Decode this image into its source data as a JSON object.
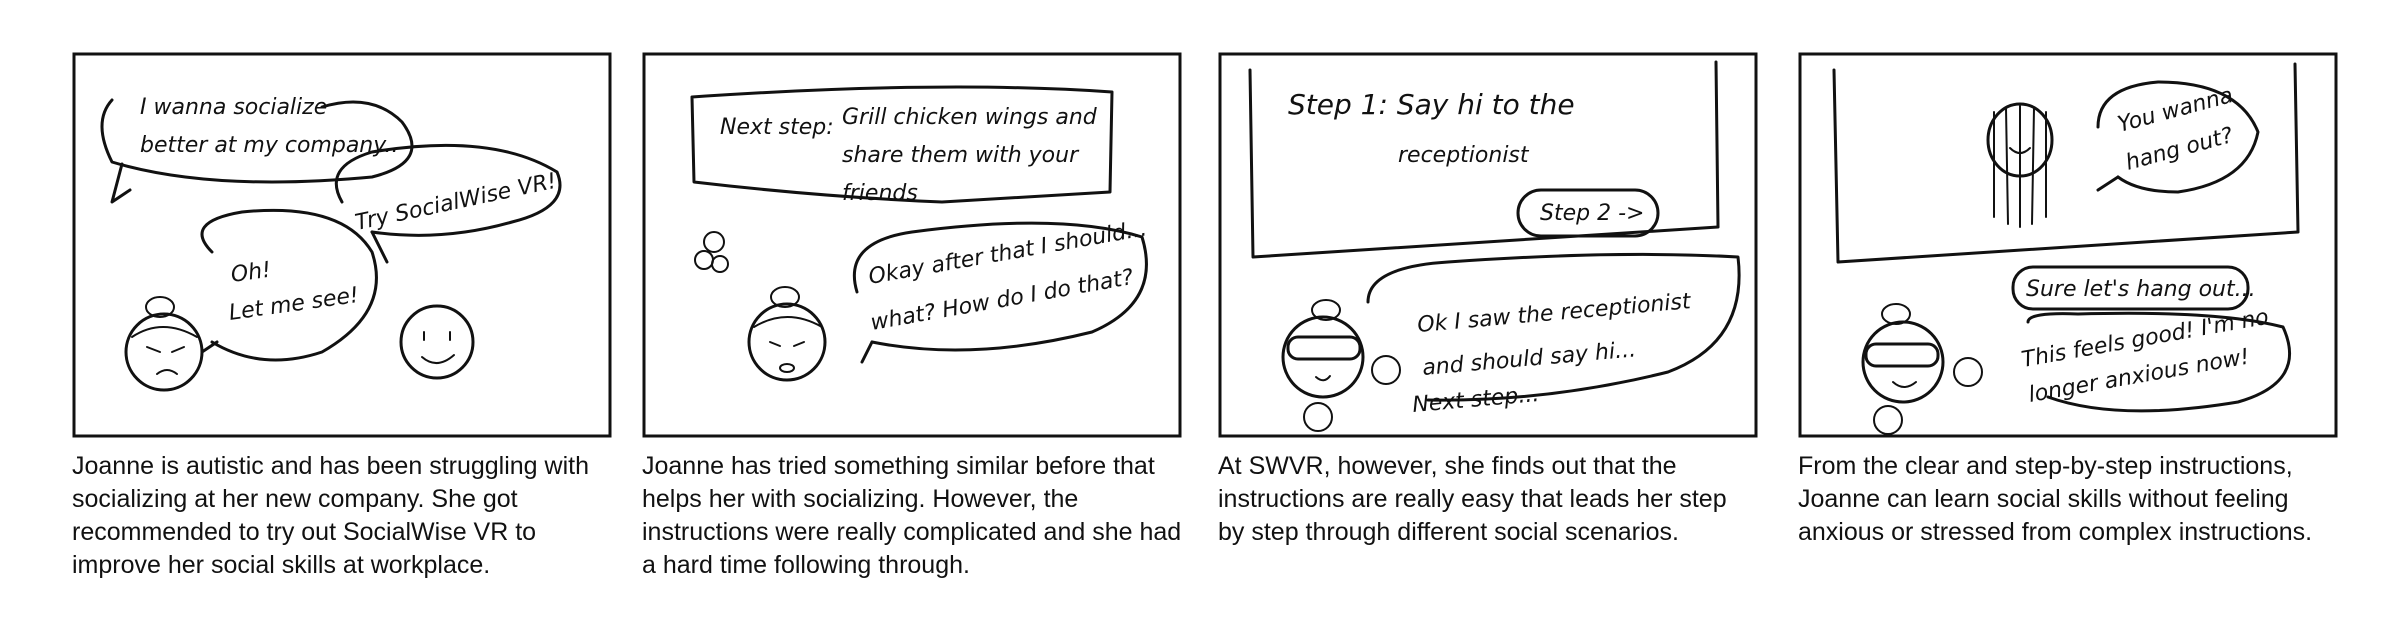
{
  "panels": [
    {
      "bubbles": [
        "I wanna socialize",
        "better at my company..",
        "Try SocialWise VR!",
        "Oh!",
        "Let me see!"
      ],
      "caption": "Joanne is autistic and has been struggling with socializing at her new company. She got recommended to try out SocialWise VR to improve her social skills at workplace."
    },
    {
      "bubbles": [
        "Next step:",
        "Grill chicken wings and",
        "share them with your",
        "friends",
        "Okay after that I should...",
        "what? How do I do that?"
      ],
      "caption": "Joanne has tried something similar before that helps her with socializing. However, the instructions were really complicated and she had a hard time following through."
    },
    {
      "bubbles": [
        "Step 1: Say hi to the",
        "receptionist",
        "Step 2 ->",
        "Ok I saw the receptionist",
        "and should say hi...",
        "Next step..."
      ],
      "caption": "At SWVR, however, she finds out that the instructions are really easy that leads her step by step through different social scenarios."
    },
    {
      "bubbles": [
        "You wanna",
        "hang out?",
        "Sure let's hang out...",
        "This feels good! I'm no",
        "longer anxious now!"
      ],
      "caption": "From the clear and step-by-step instructions, Joanne can learn social skills without feeling anxious or stressed from complex instructions."
    }
  ]
}
